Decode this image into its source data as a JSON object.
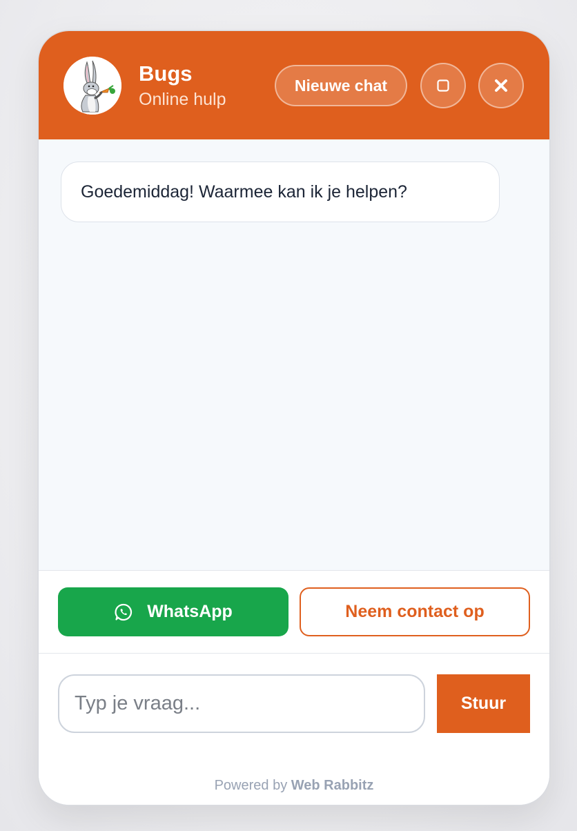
{
  "header": {
    "agent_name": "Bugs",
    "agent_status": "Online hulp",
    "new_chat_label": "Nieuwe chat",
    "minimize_icon": "square-icon",
    "close_icon": "close-icon",
    "avatar_icon": "rabbit-avatar"
  },
  "messages": [
    {
      "sender": "bot",
      "text": "Goedemiddag! Waarmee kan ik je helpen?"
    }
  ],
  "actions": {
    "whatsapp_label": "WhatsApp",
    "whatsapp_icon": "whatsapp-icon",
    "contact_label": "Neem contact op"
  },
  "composer": {
    "placeholder": "Typ je vraag...",
    "value": "",
    "send_label": "Stuur"
  },
  "footer": {
    "powered_prefix": "Powered by",
    "powered_brand": "Web Rabbitz"
  },
  "colors": {
    "accent": "#df5f1e",
    "whatsapp": "#18a64b",
    "message_area": "#f6f9fc",
    "footer_text": "#98a2b3"
  }
}
